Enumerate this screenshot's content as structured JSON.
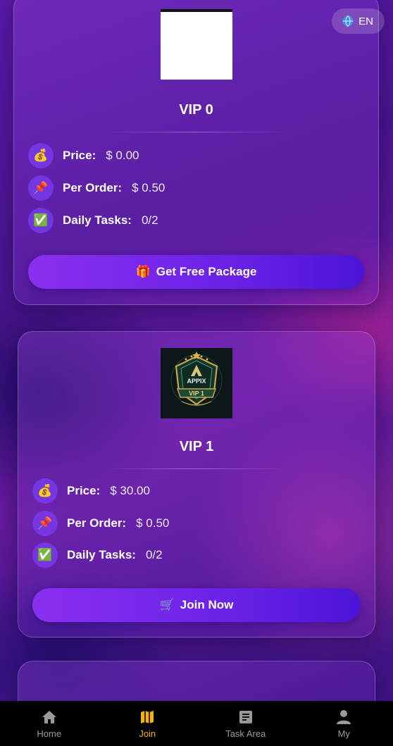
{
  "language": {
    "label": "EN",
    "icon": "globe-icon"
  },
  "packages": [
    {
      "title": "VIP 0",
      "image": "blank-package-image",
      "price_label": "Price:",
      "price_value": "$ 0.00",
      "per_order_label": "Per Order:",
      "per_order_value": "$ 0.50",
      "daily_tasks_label": "Daily Tasks:",
      "daily_tasks_value": "0/2",
      "button_icon": "gift-icon",
      "button_label": "Get Free Package"
    },
    {
      "title": "VIP 1",
      "image": "appix-vip1-badge",
      "badge_brand": "APPIX",
      "badge_level": "VIP 1",
      "price_label": "Price:",
      "price_value": "$ 30.00",
      "per_order_label": "Per Order:",
      "per_order_value": "$ 0.50",
      "daily_tasks_label": "Daily Tasks:",
      "daily_tasks_value": "0/2",
      "button_icon": "cart-icon",
      "button_label": "Join Now"
    }
  ],
  "info_icons": {
    "price": "money-bag-icon",
    "per_order": "pushpin-icon",
    "daily_tasks": "checkmark-icon"
  },
  "nav": {
    "items": [
      {
        "label": "Home",
        "icon": "home-icon",
        "active": false
      },
      {
        "label": "Join",
        "icon": "map-icon",
        "active": true
      },
      {
        "label": "Task Area",
        "icon": "document-icon",
        "active": false
      },
      {
        "label": "My",
        "icon": "user-icon",
        "active": false
      }
    ],
    "active_color": "#f5b400",
    "inactive_color": "#9a9a9a"
  },
  "colors": {
    "button_gradient_start": "#8a2ff0",
    "button_gradient_end": "#4b14d6",
    "icon_circle": "#7a3cf0"
  }
}
